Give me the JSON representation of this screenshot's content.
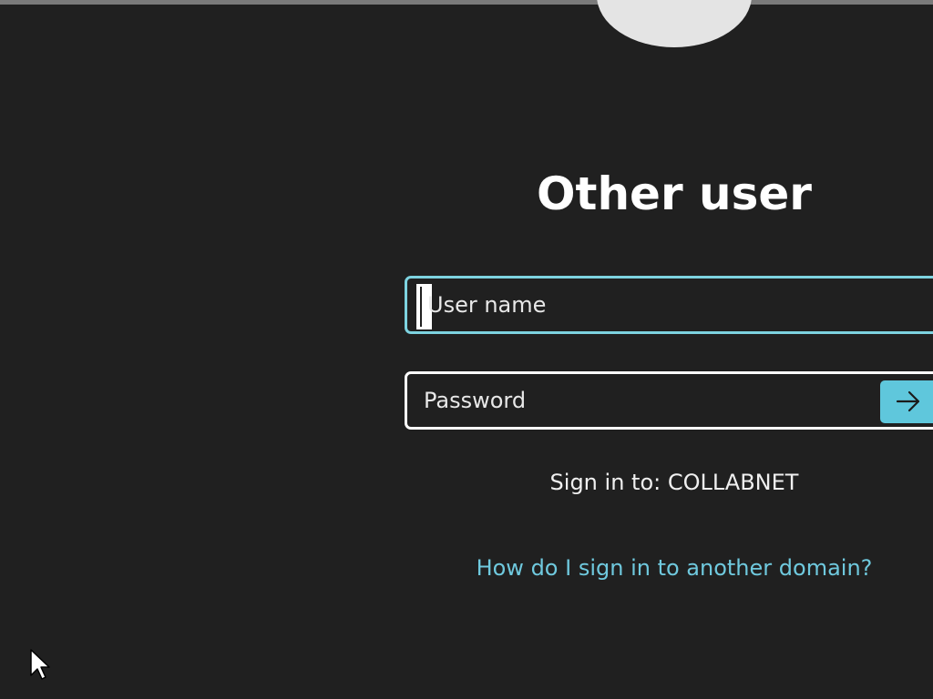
{
  "login": {
    "title": "Other user",
    "username_placeholder": "User name",
    "password_placeholder": "Password",
    "sign_in_to": "Sign in to: COLLABNET",
    "help_link": "How do I sign in to another domain?"
  },
  "icons": {
    "submit": "arrow-right-icon",
    "avatar": "user-avatar",
    "cursor": "mouse-pointer-icon"
  },
  "colors": {
    "background": "#202020",
    "accent": "#5fc7dc",
    "link": "#6fc9de",
    "focus_border": "#7dd3e0",
    "text": "#ffffff"
  }
}
